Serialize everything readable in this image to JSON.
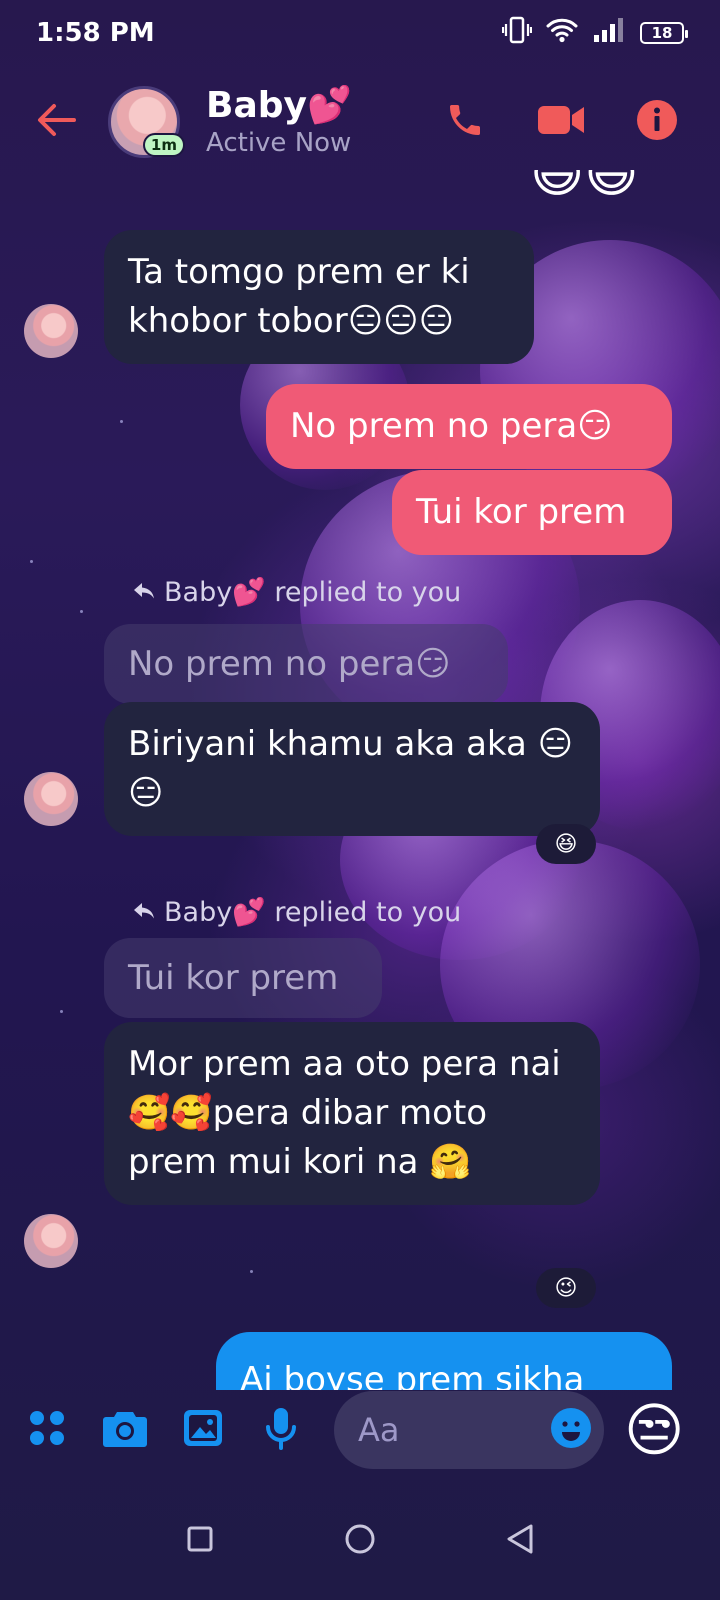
{
  "status_bar": {
    "time": "1:58 PM",
    "battery": "18",
    "icons": [
      "vibrate-icon",
      "wifi-icon",
      "signal-icon",
      "battery-icon"
    ]
  },
  "header": {
    "contact_name": "Baby💕",
    "status": "Active Now",
    "active_badge": "1m",
    "actions": [
      "phone-icon",
      "video-icon",
      "info-icon"
    ]
  },
  "messages": {
    "top_emojis": "😄😄",
    "m1": "Ta tomgo prem er ki khobor tobor😑😑😑",
    "m2": "No prem no pera😏",
    "m3": "Tui kor prem",
    "reply1_label": "Baby💕 replied to you",
    "reply1_quote": "No prem no pera😏",
    "m4": "Biriyani khamu aka aka 😑😑",
    "m4_reaction": "😆",
    "reply2_label": "Baby💕 replied to you",
    "reply2_quote": "Tui kor prem",
    "m5": "Mor prem aa oto pera nai 🥰🥰pera dibar moto prem mui kori na 🤗",
    "m5_reaction": "😉",
    "m6": "Ai boyse prem sikha"
  },
  "composer": {
    "placeholder": "Aa",
    "tools": [
      "apps-icon",
      "camera-icon",
      "gallery-icon",
      "mic-icon"
    ],
    "quick_emoji": "😒"
  },
  "nav_bar": [
    "recents-icon",
    "home-icon",
    "back-icon"
  ],
  "colors": {
    "accent": "#f05a76",
    "outgoing_bubble": "#f05a76",
    "outgoing_blue": "#1591f0",
    "incoming_bubble": "#22243f",
    "icon_blue": "#1591f0"
  }
}
